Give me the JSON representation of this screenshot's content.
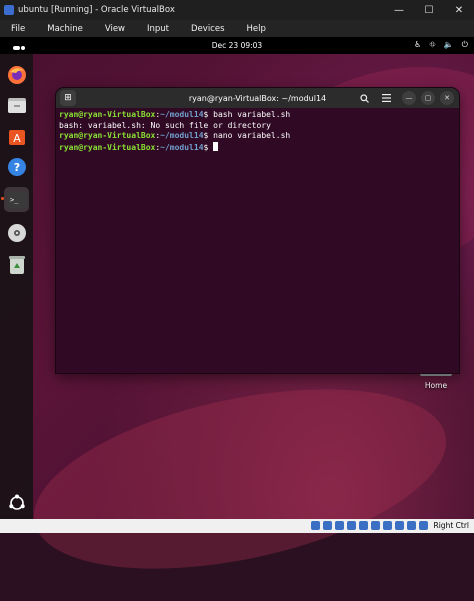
{
  "host_window": {
    "title": "ubuntu [Running] - Oracle VirtualBox",
    "controls": [
      "minimize",
      "maximize",
      "close"
    ],
    "control_glyphs": [
      "—",
      "☐",
      "✕"
    ]
  },
  "host_menu": [
    "File",
    "Machine",
    "View",
    "Input",
    "Devices",
    "Help"
  ],
  "ubuntu_topbar": {
    "clock": "Dec 23  09:03",
    "tray_icons": [
      "accessibility-icon",
      "network-icon",
      "volume-icon",
      "power-icon"
    ],
    "tray_glyphs": [
      "♿",
      "⛗",
      "🔈",
      "⏻"
    ]
  },
  "dock": {
    "items": [
      "firefox",
      "files",
      "app-center",
      "help",
      "terminal",
      "disc",
      "trash"
    ],
    "glyphs": [
      "🦊",
      "🗀",
      "A",
      "?",
      ">_",
      "◉",
      "♻"
    ]
  },
  "terminal": {
    "title": "ryan@ryan-VirtualBox: ~/modul14",
    "lines": [
      {
        "user": "ryan@ryan-VirtualBox",
        "sep": ":",
        "path": "~/modul14",
        "cmd": "$ bash variabel.sh"
      },
      {
        "output": "bash: variabel.sh: No such file or directory"
      },
      {
        "user": "ryan@ryan-VirtualBox",
        "sep": ":",
        "path": "~/modul14",
        "cmd": "$ nano variabel.sh"
      },
      {
        "user": "ryan@ryan-VirtualBox",
        "sep": ":",
        "path": "~/modul14",
        "cmd": "$ "
      }
    ]
  },
  "desktop": {
    "home_label": "Home"
  },
  "host_status": {
    "host_key": "Right Ctrl"
  },
  "colors": {
    "terminal_bg": "#300a24",
    "prompt_user": "#8ae234",
    "prompt_path": "#729fcf",
    "accent": "#e95420"
  }
}
